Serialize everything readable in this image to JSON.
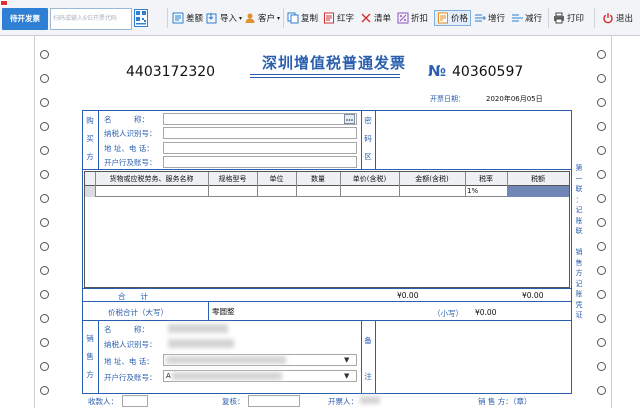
{
  "toolbar": {
    "pending_label": "待开发票",
    "search_placeholder": "扫码或输入6位开票代码",
    "buttons": {
      "diff": "差额",
      "import": "导入",
      "customer": "客户",
      "copy": "复制",
      "red": "红字",
      "list": "清单",
      "discount": "折扣",
      "price": "价格",
      "add_row": "增行",
      "remove_row": "减行",
      "print": "打印",
      "exit": "退出"
    }
  },
  "invoice": {
    "code": "4403172320",
    "title": "深圳增值税普通发票",
    "number_symbol": "№",
    "number": "40360597",
    "date_label": "开票日期：",
    "date": "2020年06月05日",
    "buyer": {
      "side_label": [
        "购",
        "买",
        "方"
      ],
      "name_label": "名　　　称：",
      "tax_id_label": "纳税人识别号：",
      "address_label": "地 址、电 话：",
      "bank_label": "开户行及账号："
    },
    "cipher_label": [
      "密",
      "码",
      "区"
    ],
    "columns": [
      "货物或应税劳务、服务名称",
      "规格型号",
      "单位",
      "数量",
      "单价(含税)",
      "金额(含税)",
      "税率",
      "税额"
    ],
    "first_row_rate": "1%",
    "totals": {
      "label": "合　　计",
      "amount": "¥0.00",
      "tax": "¥0.00"
    },
    "grand_total": {
      "label": "价税合计（大写）",
      "uppercase": "零圆整",
      "small_label": "（小写）",
      "small_value": "¥0.00"
    },
    "seller": {
      "side_label": [
        "销",
        "售",
        "方"
      ],
      "name_label": "名　　　称：",
      "tax_id_label": "纳税人识别号：",
      "address_label": "地 址、电 话：",
      "bank_label": "开户行及账号：",
      "bank_value_partial": "A"
    },
    "remark_label": [
      "备",
      "注"
    ],
    "footer": {
      "payee_label": "收款人：",
      "reviewer_label": "复核：",
      "issuer_label": "开票人：",
      "seller_seal_label": "销 售 方：（章）"
    },
    "side_note": [
      "第",
      "一",
      "联",
      "：",
      "记",
      "账",
      "联",
      "　",
      "销",
      "售",
      "方",
      "记",
      "账",
      "凭",
      "证"
    ]
  },
  "colors": {
    "accent": "#2f7fd4",
    "invoice_blue": "#2a5fb0",
    "selected_cell": "#6f86b6"
  }
}
